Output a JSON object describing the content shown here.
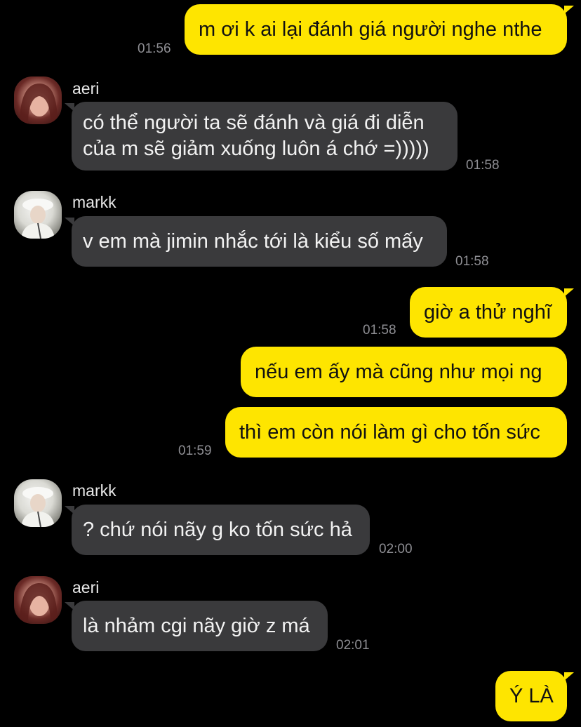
{
  "messages": [
    {
      "text": "m ơi k ai lại đánh giá người nghe nthe",
      "time": "01:56"
    },
    {
      "sender": "aeri",
      "line1": "có thể người ta sẽ đánh và giá đi diễn",
      "line2": "của m sẽ giảm xuống luôn á chớ =)))))",
      "time": "01:58"
    },
    {
      "sender": "markk",
      "text": "v em mà jimin nhắc tới là kiểu số mấy",
      "time": "01:58"
    },
    {
      "text": "giờ a thử nghĩ",
      "time": "01:58"
    },
    {
      "text": "nếu em ấy mà cũng như mọi ng"
    },
    {
      "text": "thì em còn nói làm gì cho tốn sức",
      "time": "01:59"
    },
    {
      "sender": "markk",
      "text": "? chứ nói nãy g ko tốn sức hả",
      "time": "02:00"
    },
    {
      "sender": "aeri",
      "text": "là nhảm cgi nãy giờ z má",
      "time": "02:01"
    },
    {
      "text": "Ý LÀ"
    }
  ],
  "colors": {
    "background": "#000000",
    "my_bubble": "#fee500",
    "their_bubble": "#3a3a3c",
    "timestamp": "#8e8e93"
  }
}
